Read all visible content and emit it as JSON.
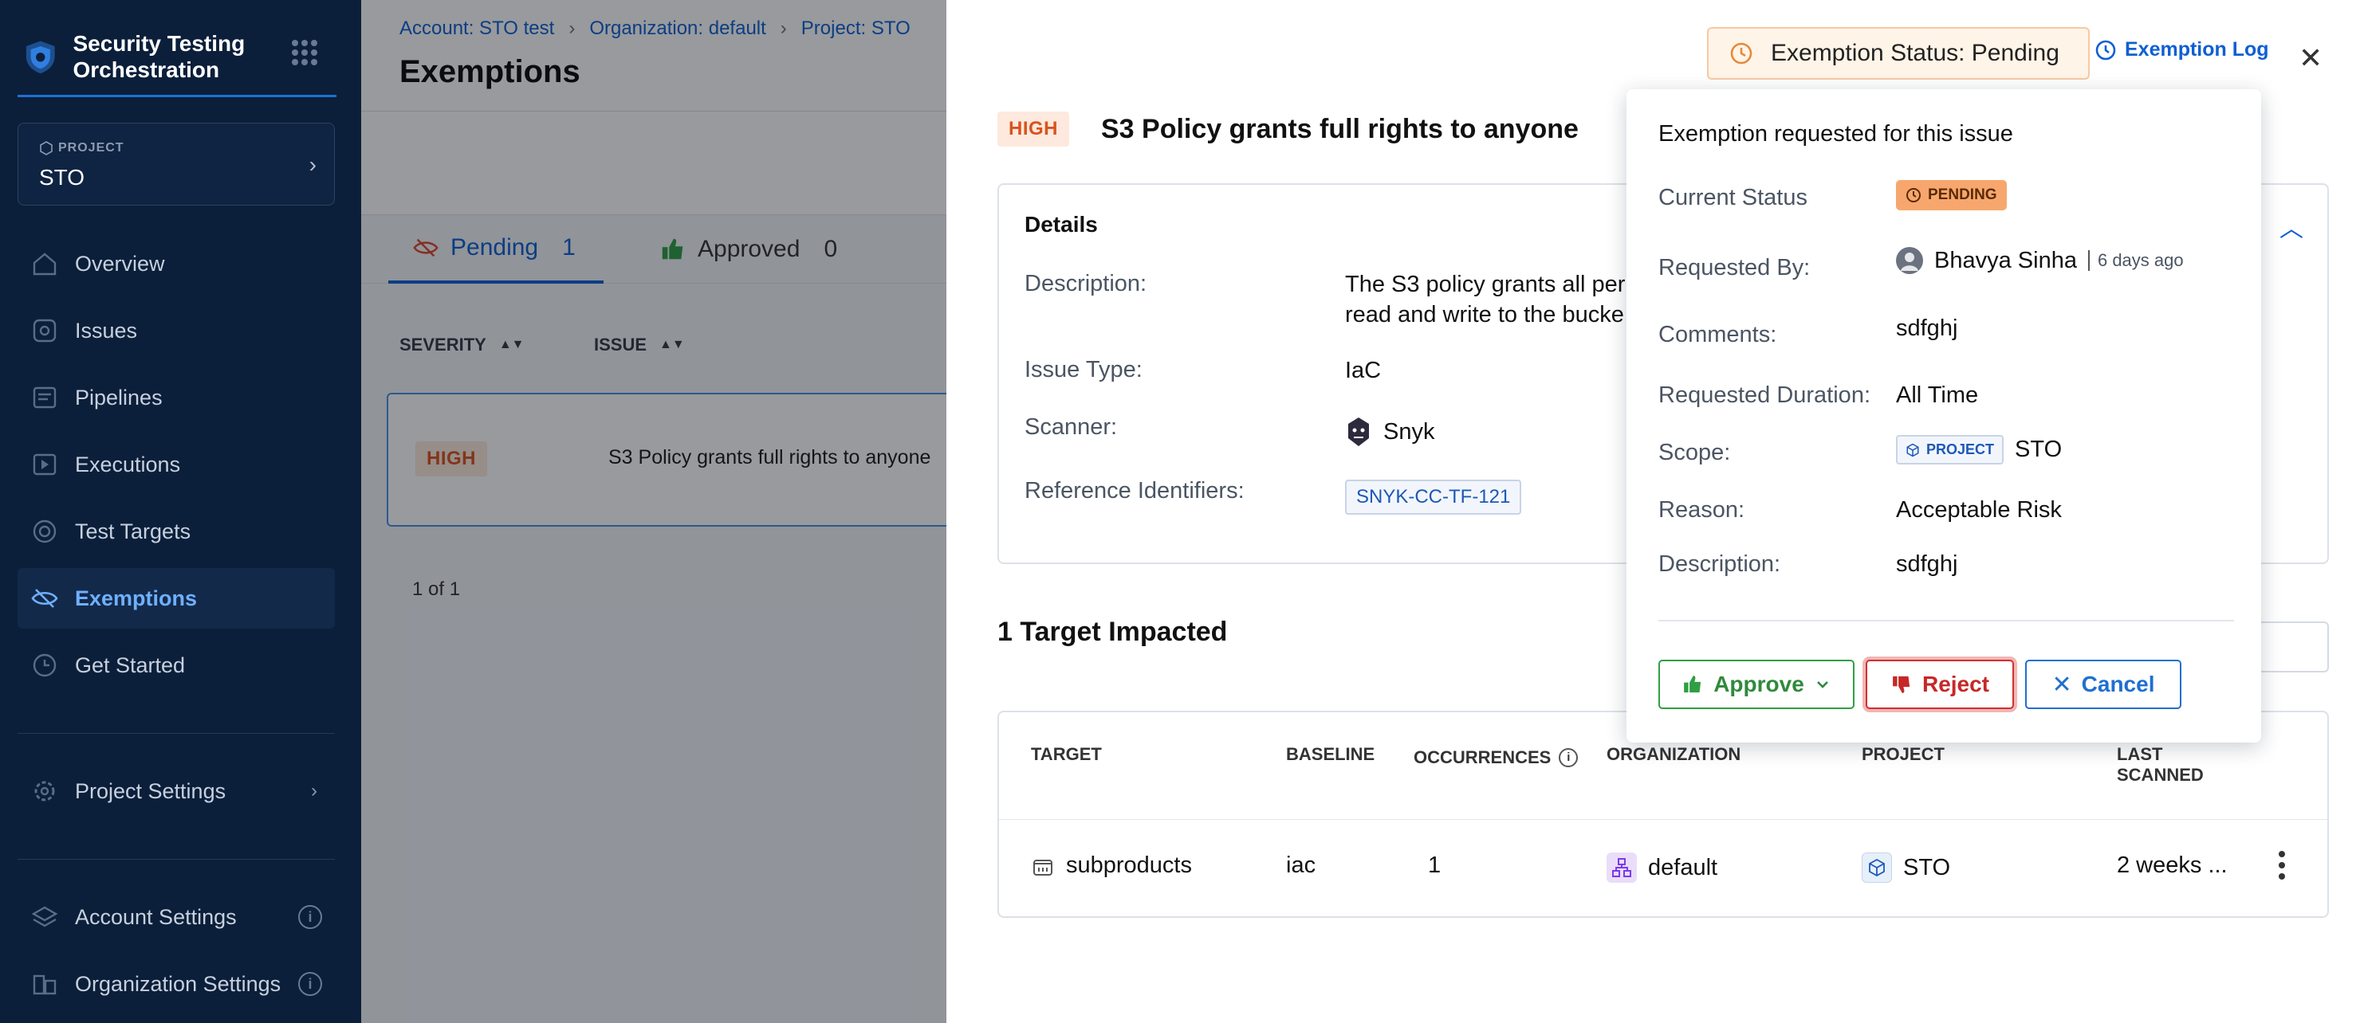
{
  "sidebar": {
    "brand": "Security Testing Orchestration",
    "project_label": "PROJECT",
    "project_value": "STO",
    "nav": [
      {
        "label": "Overview",
        "icon": "home-icon"
      },
      {
        "label": "Issues",
        "icon": "issues-icon"
      },
      {
        "label": "Pipelines",
        "icon": "pipelines-icon"
      },
      {
        "label": "Executions",
        "icon": "executions-icon"
      },
      {
        "label": "Test Targets",
        "icon": "target-icon"
      },
      {
        "label": "Exemptions",
        "icon": "eye-slash-icon"
      },
      {
        "label": "Get Started",
        "icon": "get-started-icon"
      }
    ],
    "project_settings": "Project Settings",
    "account_settings": "Account Settings",
    "organization_settings": "Organization Settings"
  },
  "main": {
    "breadcrumbs": [
      "Account: STO test",
      "Organization: default",
      "Project: STO"
    ],
    "title": "Exemptions",
    "tabs": [
      {
        "label": "Pending",
        "count": "1"
      },
      {
        "label": "Approved",
        "count": "0"
      }
    ],
    "columns": [
      "SEVERITY",
      "ISSUE"
    ],
    "row": {
      "severity": "HIGH",
      "issue": "S3 Policy grants full rights to anyone"
    },
    "pager": "1 of 1"
  },
  "drawer": {
    "status_pill": "Exemption Status: Pending",
    "exemption_log": "Exemption Log",
    "severity": "HIGH",
    "issue_title": "S3 Policy grants full rights to anyone",
    "details": {
      "title": "Details",
      "description_label": "Description:",
      "description_value_line1": "The S3 policy grants all per",
      "description_value_line2": "read and write to the bucke",
      "issue_type_label": "Issue Type:",
      "issue_type_value": "IaC",
      "scanner_label": "Scanner:",
      "scanner_value": "Snyk",
      "ref_label": "Reference Identifiers:",
      "ref_value": "SNYK-CC-TF-121"
    },
    "targets_title": "1 Target Impacted",
    "table": {
      "headers": [
        "TARGET",
        "BASELINE",
        "OCCURRENCES",
        "ORGANIZATION",
        "PROJECT",
        "LAST",
        "SCANNED"
      ],
      "row": {
        "target": "subproducts",
        "baseline": "iac",
        "occurrences": "1",
        "organization": "default",
        "project": "STO",
        "last_scanned": "2 weeks ..."
      }
    }
  },
  "popover": {
    "title": "Exemption requested for this issue",
    "current_status_label": "Current Status",
    "current_status_value": "PENDING",
    "requested_by_label": "Requested By:",
    "requested_by_value": "Bhavya Sinha",
    "requested_ago": "6 days ago",
    "comments_label": "Comments:",
    "comments_value": "sdfghj",
    "duration_label": "Requested Duration:",
    "duration_value": "All Time",
    "scope_label": "Scope:",
    "scope_chip": "PROJECT",
    "scope_value": "STO",
    "reason_label": "Reason:",
    "reason_value": "Acceptable Risk",
    "description_label": "Description:",
    "description_value": "sdfghj",
    "approve": "Approve",
    "reject": "Reject",
    "cancel": "Cancel"
  },
  "colors": {
    "sidebar_bg": "#0b1f3a",
    "accent_blue": "#0f5fd3",
    "high_severity": "#d9531e",
    "pending_orange": "#f7a76d",
    "approve_green": "#2f9e44",
    "reject_red": "#d32f2f"
  }
}
